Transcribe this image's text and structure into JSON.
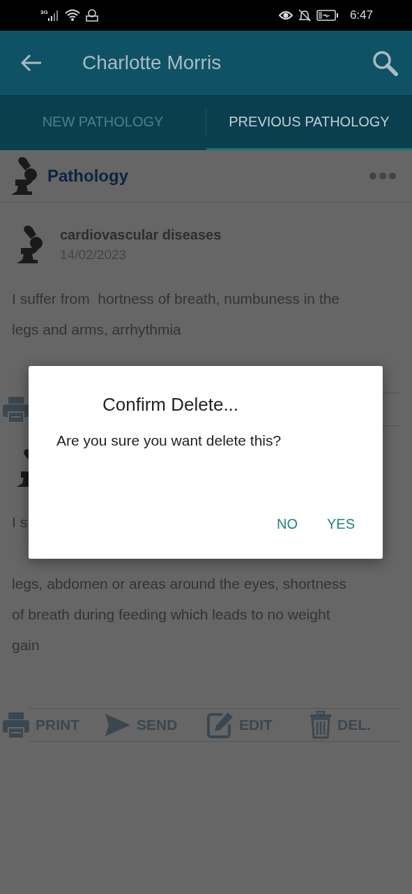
{
  "status_bar": {
    "network": "3G",
    "time": "6:47"
  },
  "app_bar": {
    "title": "Charlotte Morris"
  },
  "tabs": [
    {
      "label": "NEW PATHOLOGY",
      "selected": false
    },
    {
      "label": "PREVIOUS PATHOLOGY",
      "selected": true
    }
  ],
  "section": {
    "title": "Pathology"
  },
  "records": [
    {
      "title": "cardiovascular diseases",
      "date": "14/02/2023",
      "body_lines": [
        "I suffer from  hortness of breath, numbuness in the",
        "legs and arms, arrhythmia"
      ],
      "actions": [
        {
          "kind": "print"
        }
      ]
    },
    {
      "body_first": "I s",
      "body_lines": [
        "legs, abdomen or areas around the eyes, shortness",
        "of breath during feeding which leads to no weight",
        "gain"
      ],
      "actions": [
        {
          "kind": "print",
          "label": "PRINT"
        },
        {
          "kind": "send",
          "label": "SEND"
        },
        {
          "kind": "edit",
          "label": "EDIT"
        },
        {
          "kind": "delete",
          "label": "DEL."
        }
      ]
    }
  ],
  "dialog": {
    "title": "Confirm Delete...",
    "message": "Are you sure you want delete this?",
    "buttons": [
      "NO",
      "YES"
    ]
  }
}
